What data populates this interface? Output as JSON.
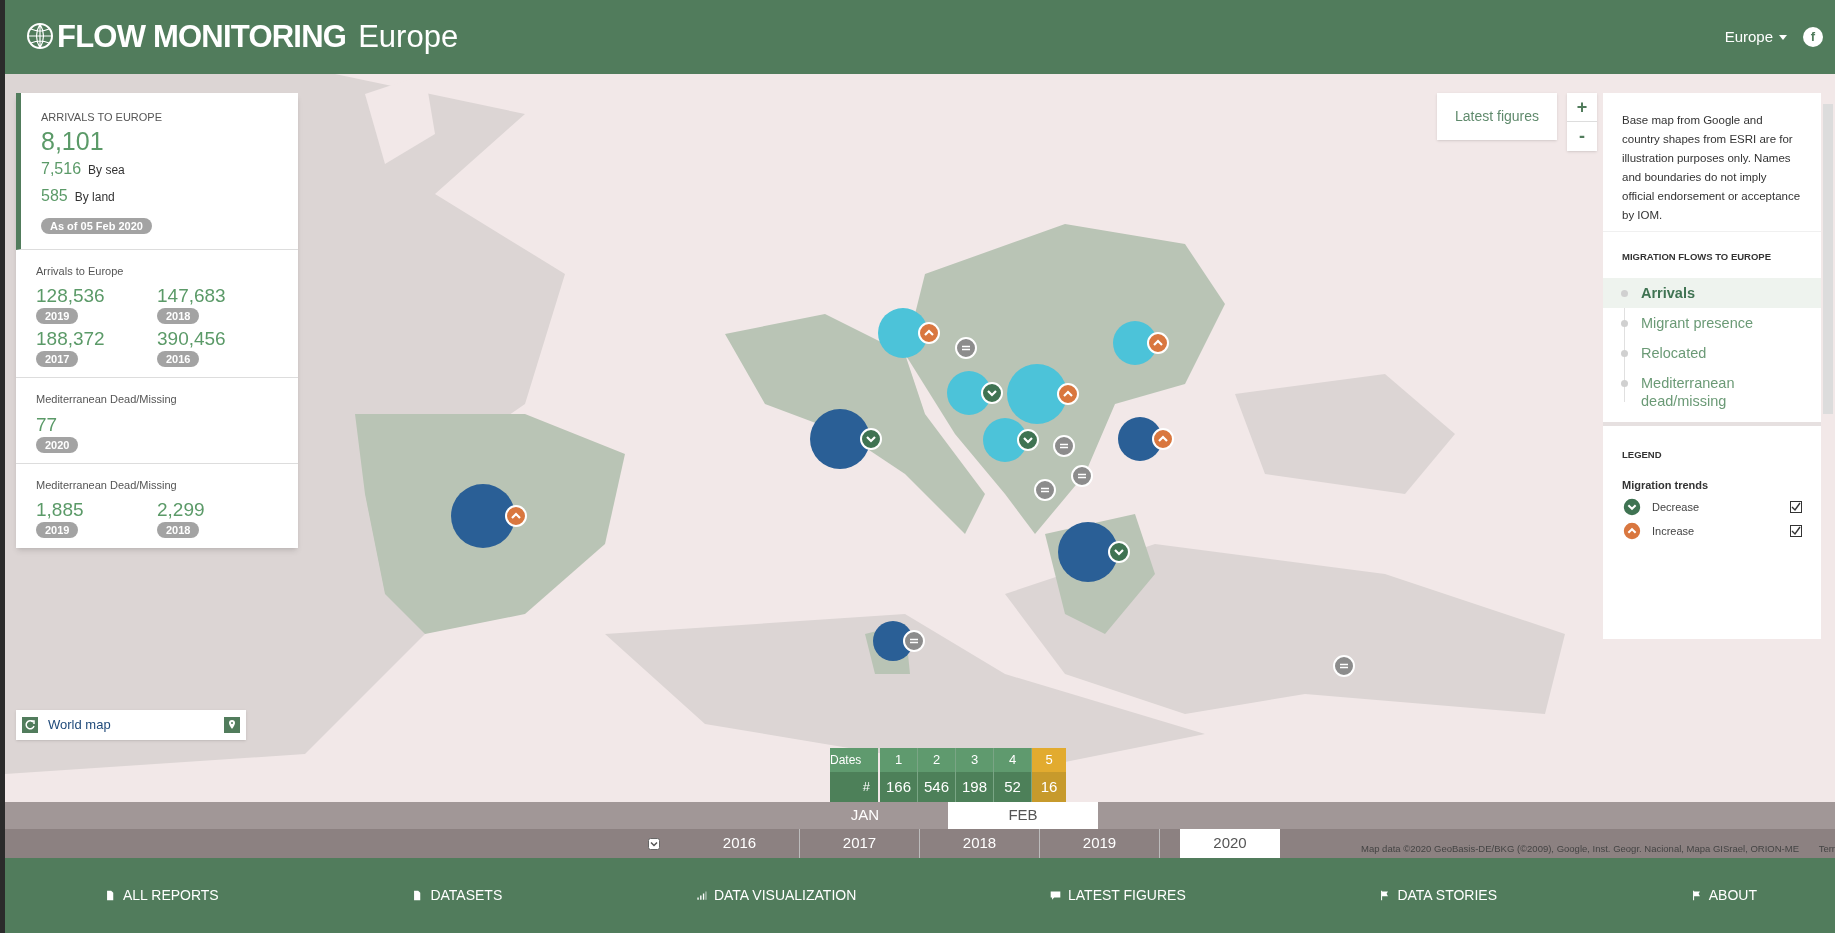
{
  "header": {
    "brand": "FLOW MONITORING",
    "region": "Europe",
    "region_menu": "Europe",
    "social": "f"
  },
  "summary": {
    "title": "ARRIVALS TO EUROPE",
    "total": "8,101",
    "parts": [
      {
        "value": "7,516",
        "label": "By sea"
      },
      {
        "value": "585",
        "label": "By land"
      }
    ],
    "as_of": "As of 05 Feb 2020"
  },
  "stats": [
    {
      "title": "Arrivals to Europe",
      "figures": [
        {
          "value": "128,536",
          "year": "2019"
        },
        {
          "value": "147,683",
          "year": "2018"
        },
        {
          "value": "188,372",
          "year": "2017"
        },
        {
          "value": "390,456",
          "year": "2016"
        }
      ]
    },
    {
      "title": "Mediterranean Dead/Missing",
      "figures": [
        {
          "value": "77",
          "year": "2020"
        }
      ]
    },
    {
      "title": "Mediterranean Dead/Missing",
      "figures": [
        {
          "value": "1,885",
          "year": "2019"
        },
        {
          "value": "2,299",
          "year": "2018"
        }
      ]
    }
  ],
  "map_controls": {
    "latest_figures": "Latest figures",
    "zoom_in": "+",
    "zoom_out": "-"
  },
  "info_panel": {
    "disclaimer": "Base map from Google and country shapes from ESRI are for illustration purposes only. Names and boundaries do not imply official endorsement or acceptance by IOM.",
    "flows_title": "MIGRATION FLOWS TO EUROPE",
    "flows": [
      {
        "label": "Arrivals",
        "selected": true
      },
      {
        "label": "Migrant presence",
        "selected": false
      },
      {
        "label": "Relocated",
        "selected": false
      },
      {
        "label": "Mediterranean dead/missing",
        "selected": false
      }
    ],
    "legend_title": "LEGEND",
    "legend_group": "Migration trends",
    "legend_items": [
      {
        "kind": "decrease",
        "label": "Decrease",
        "checked": true
      },
      {
        "kind": "increase",
        "label": "Increase",
        "checked": true
      }
    ]
  },
  "markers": [
    {
      "kind": "increase",
      "color": "#2a5f96"
    },
    {
      "kind": "decrease",
      "color": "#2a5f96"
    },
    {
      "kind": "increase",
      "color": "#4cc3d9"
    },
    {
      "kind": "stable"
    },
    {
      "kind": "decrease",
      "color": "#4cc3d9"
    },
    {
      "kind": "increase",
      "color": "#4cc3d9"
    },
    {
      "kind": "decrease",
      "color": "#4cc3d9"
    },
    {
      "kind": "stable"
    },
    {
      "kind": "stable"
    },
    {
      "kind": "stable"
    },
    {
      "kind": "increase",
      "color": "#4cc3d9"
    },
    {
      "kind": "increase",
      "color": "#2a5f96"
    },
    {
      "kind": "decrease",
      "color": "#2a5f96"
    },
    {
      "kind": "stable",
      "color": "#2a5f96"
    },
    {
      "kind": "stable"
    }
  ],
  "world_map": "World map",
  "dates": {
    "label": "Dates",
    "count_label": "#",
    "days": [
      {
        "day": "1",
        "count": "166",
        "selected": false
      },
      {
        "day": "2",
        "count": "546",
        "selected": false
      },
      {
        "day": "3",
        "count": "198",
        "selected": false
      },
      {
        "day": "4",
        "count": "52",
        "selected": false
      },
      {
        "day": "5",
        "count": "16",
        "selected": true
      }
    ]
  },
  "months": [
    {
      "label": "JAN",
      "selected": false
    },
    {
      "label": "FEB",
      "selected": true
    }
  ],
  "years": [
    {
      "label": "2016",
      "selected": false
    },
    {
      "label": "2017",
      "selected": false
    },
    {
      "label": "2018",
      "selected": false
    },
    {
      "label": "2019",
      "selected": false
    },
    {
      "label": "2020",
      "selected": true
    }
  ],
  "attribution": "Map data ©2020 GeoBasis-DE/BKG (©2009), Google, Inst. Geogr. Nacional, Mapa GISrael, ORION-ME",
  "attribution_cut": "Terr",
  "nav": [
    {
      "label": "ALL REPORTS"
    },
    {
      "label": "DATASETS"
    },
    {
      "label": "DATA VISUALIZATION"
    },
    {
      "label": "LATEST FIGURES"
    },
    {
      "label": "DATA STORIES"
    },
    {
      "label": "ABOUT"
    }
  ]
}
